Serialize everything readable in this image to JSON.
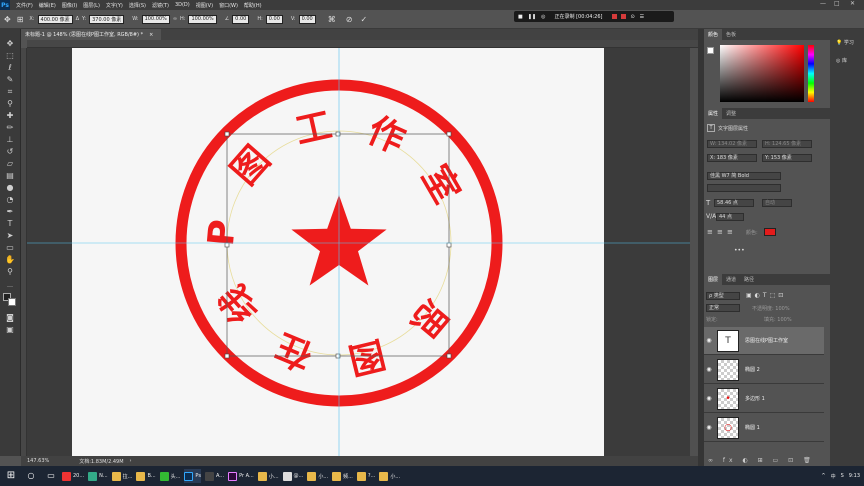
{
  "app": {
    "logo": "Ps",
    "menu": [
      "文件(F)",
      "编辑(E)",
      "图像(I)",
      "图层(L)",
      "文字(Y)",
      "选择(S)",
      "滤镜(T)",
      "3D(D)",
      "视图(V)",
      "窗口(W)",
      "帮助(H)"
    ]
  },
  "options": {
    "x": "400.00 像素",
    "y": "370.00 像素",
    "w": "100.00%",
    "h": "100.00%",
    "angle": "0.00",
    "hskew": "0.00",
    "vskew": "0.00",
    "label_w": "W:",
    "label_h": "H:",
    "label_h2": "H:",
    "label_v": "V:"
  },
  "recorder": {
    "status": "正在录制 [00:04:26]"
  },
  "document": {
    "tab_title": "未标题-1 @ 148% (思图在线P图工作室, RGB/8#) *",
    "tab_close": "×"
  },
  "stamp": {
    "chars": [
      "思",
      "图",
      "在",
      "线",
      "P",
      "图",
      "工",
      "作",
      "室"
    ],
    "color": "#ee1c1c",
    "guide_color": "#55c3f0"
  },
  "status": {
    "zoom": "147.63%",
    "doc": "文档:1.83M/2.49M"
  },
  "color_panel": {
    "tabs": [
      "颜色",
      "色板"
    ],
    "hue_color": "#ff0000"
  },
  "properties": {
    "tabs": [
      "属性",
      "调整"
    ],
    "kind": "文字图层属性",
    "w": "W: 134.02 像素",
    "h": "H: 124.65 像素",
    "x": "X: 183 像素",
    "y": "Y: 153 像素",
    "font": "佳黑 W7 简 Bold",
    "size": "58.46 点",
    "leading": "自动",
    "tracking": "44 点",
    "color_label": "颜色:",
    "text_color": "#e31b1b"
  },
  "layers": {
    "tabs": [
      "图层",
      "通道",
      "路径"
    ],
    "kind_filter": "ρ 类型",
    "blend_mode": "正常",
    "opacity": "不透明度: 100%",
    "fill": "填充: 100%",
    "lock": "锁定:",
    "items": [
      {
        "name": "思图在线P图工作室",
        "thumb": "T",
        "selected": true
      },
      {
        "name": "椭圆 2",
        "thumb": "",
        "selected": false
      },
      {
        "name": "多边形 1",
        "thumb": "•",
        "selected": false
      },
      {
        "name": "椭圆 1",
        "thumb": "○",
        "selected": false
      }
    ]
  },
  "right_panel": {
    "items": [
      "学习",
      "库"
    ]
  },
  "taskbar": {
    "apps": [
      "20...",
      "N...",
      "拉...",
      "B...",
      "头...",
      "Ps",
      "A...",
      "Pr A...",
      "小...",
      "@...",
      "小...",
      "频...",
      "?...",
      "小..."
    ],
    "tray": [
      "中",
      "S",
      "9:13"
    ]
  }
}
